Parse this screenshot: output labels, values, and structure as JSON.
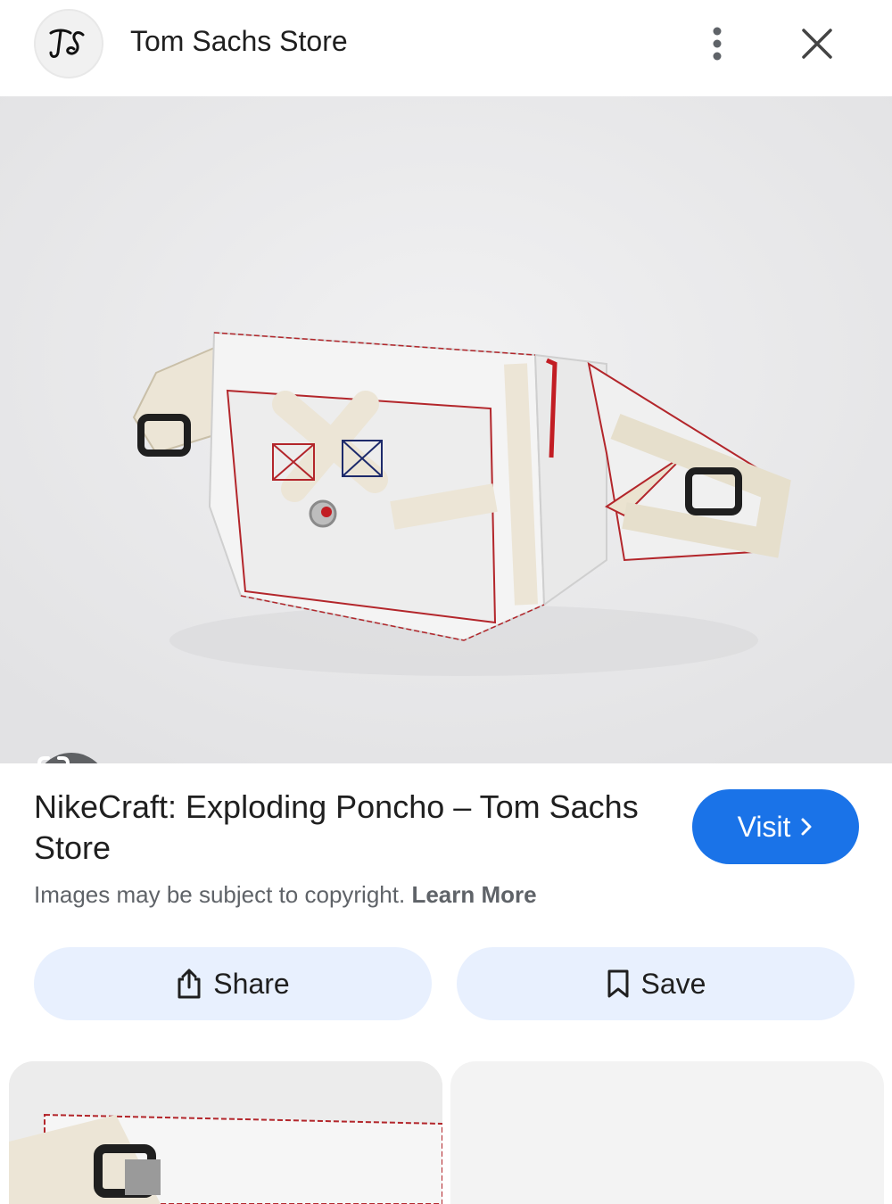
{
  "header": {
    "site_name": "Tom Sachs Store",
    "logo_text": "TS",
    "more_icon": "more-vertical-icon",
    "close_icon": "close-icon"
  },
  "hero": {
    "lens_icon": "google-lens-icon"
  },
  "result": {
    "title": "NikeCraft: Exploding Poncho – Tom Sachs Store",
    "visit_label": "Visit",
    "copyright_text": "Images may be subject to copyright.",
    "learn_more": "Learn More"
  },
  "actions": {
    "share_label": "Share",
    "save_label": "Save"
  },
  "colors": {
    "accent": "#1a73e8",
    "action_bg": "#e8f0fe",
    "lens_bg": "#5f6164"
  }
}
